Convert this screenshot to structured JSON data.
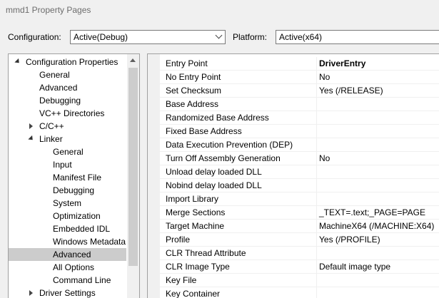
{
  "window": {
    "title": "mmd1 Property Pages"
  },
  "toolbar": {
    "configuration_label": "Configuration:",
    "configuration_value": "Active(Debug)",
    "platform_label": "Platform:",
    "platform_value": "Active(x64)"
  },
  "tree": {
    "root": "Configuration Properties",
    "items": [
      "General",
      "Advanced",
      "Debugging",
      "VC++ Directories",
      "C/C++",
      "Linker",
      "General",
      "Input",
      "Manifest File",
      "Debugging",
      "System",
      "Optimization",
      "Embedded IDL",
      "Windows Metadata",
      "Advanced",
      "All Options",
      "Command Line",
      "Driver Settings"
    ]
  },
  "properties": [
    {
      "name": "Entry Point",
      "value": "DriverEntry"
    },
    {
      "name": "No Entry Point",
      "value": "No"
    },
    {
      "name": "Set Checksum",
      "value": "Yes (/RELEASE)"
    },
    {
      "name": "Base Address",
      "value": ""
    },
    {
      "name": "Randomized Base Address",
      "value": ""
    },
    {
      "name": "Fixed Base Address",
      "value": ""
    },
    {
      "name": "Data Execution Prevention (DEP)",
      "value": ""
    },
    {
      "name": "Turn Off Assembly Generation",
      "value": "No"
    },
    {
      "name": "Unload delay loaded DLL",
      "value": ""
    },
    {
      "name": "Nobind delay loaded DLL",
      "value": ""
    },
    {
      "name": "Import Library",
      "value": ""
    },
    {
      "name": "Merge Sections",
      "value": "_TEXT=.text;_PAGE=PAGE"
    },
    {
      "name": "Target Machine",
      "value": "MachineX64 (/MACHINE:X64)"
    },
    {
      "name": "Profile",
      "value": "Yes (/PROFILE)"
    },
    {
      "name": "CLR Thread Attribute",
      "value": ""
    },
    {
      "name": "CLR Image Type",
      "value": "Default image type"
    },
    {
      "name": "Key File",
      "value": ""
    },
    {
      "name": "Key Container",
      "value": ""
    }
  ]
}
